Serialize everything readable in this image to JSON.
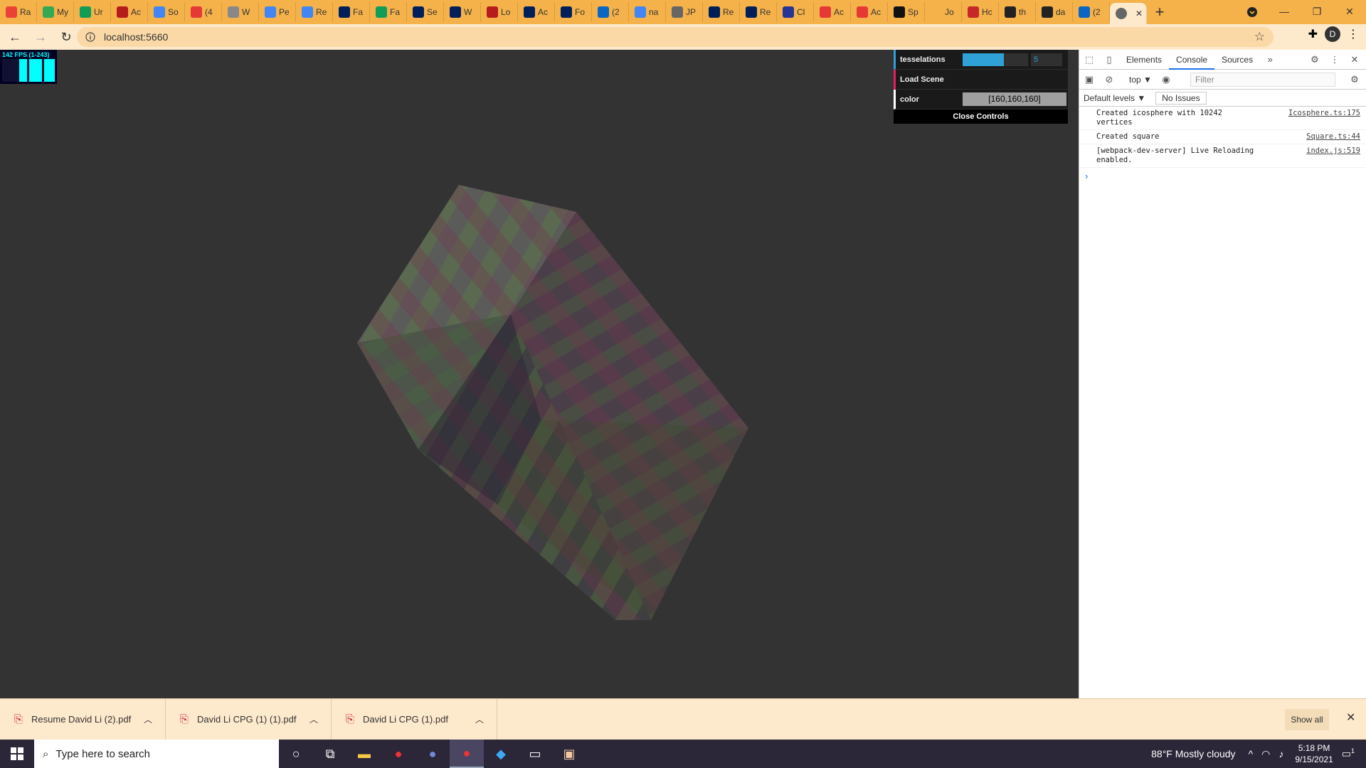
{
  "browser": {
    "tabs": [
      {
        "label": "Ra",
        "icon": "gmail-icon",
        "color": "#ea4335"
      },
      {
        "label": "My",
        "icon": "drive-icon",
        "color": "#34a853"
      },
      {
        "label": "Ur",
        "icon": "sheets-plus-icon",
        "color": "#0f9d58"
      },
      {
        "label": "Ac",
        "icon": "person-icon",
        "color": "#b71c1c"
      },
      {
        "label": "So",
        "icon": "fb-icon",
        "color": "#4285f4"
      },
      {
        "label": "(4",
        "icon": "h-icon",
        "color": "#e53935"
      },
      {
        "label": "W",
        "icon": "w-icon",
        "color": "#888888"
      },
      {
        "label": "Pe",
        "icon": "docs-icon",
        "color": "#4285f4"
      },
      {
        "label": "Re",
        "icon": "docs-icon",
        "color": "#4285f4"
      },
      {
        "label": "Fa",
        "icon": "penn-icon",
        "color": "#011f5b"
      },
      {
        "label": "Fa",
        "icon": "sheets-plus-icon",
        "color": "#0f9d58"
      },
      {
        "label": "Se",
        "icon": "penn-icon",
        "color": "#011f5b"
      },
      {
        "label": "W",
        "icon": "penn-icon",
        "color": "#011f5b"
      },
      {
        "label": "Lo",
        "icon": "person-icon",
        "color": "#b71c1c"
      },
      {
        "label": "Ac",
        "icon": "penn-icon",
        "color": "#011f5b"
      },
      {
        "label": "Fo",
        "icon": "penn-icon",
        "color": "#011f5b"
      },
      {
        "label": "(2",
        "icon": "linkedin-icon",
        "color": "#0a66c2"
      },
      {
        "label": "na",
        "icon": "google-icon",
        "color": "#4285f4"
      },
      {
        "label": "JP",
        "icon": "globe-icon",
        "color": "#666666"
      },
      {
        "label": "Re",
        "icon": "penn-icon",
        "color": "#011f5b"
      },
      {
        "label": "Re",
        "icon": "penn-icon",
        "color": "#011f5b"
      },
      {
        "label": "Cl",
        "icon": "calendar-icon",
        "color": "#283593"
      },
      {
        "label": "Ac",
        "icon": "acrobat-icon",
        "color": "#e53935"
      },
      {
        "label": "Ac",
        "icon": "acrobat-icon",
        "color": "#e53935"
      },
      {
        "label": "Sp",
        "icon": "x-icon",
        "color": "#111111"
      },
      {
        "label": "Jo",
        "icon": "blank-icon",
        "color": "#f5b24a"
      },
      {
        "label": "Hc",
        "icon": "hc-icon",
        "color": "#c62828"
      },
      {
        "label": "th",
        "icon": "github-icon",
        "color": "#222222"
      },
      {
        "label": "da",
        "icon": "github-icon",
        "color": "#222222"
      },
      {
        "label": "(2",
        "icon": "linkedin-icon",
        "color": "#0a66c2"
      }
    ],
    "url": "localhost:5660",
    "profile_initial": "D"
  },
  "stats": {
    "fps_text": "142 FPS (1-243)"
  },
  "gui": {
    "tesselations_label": "tesselations",
    "tesselations_value": "5",
    "tesselations_fraction": 0.63,
    "load_scene_label": "Load Scene",
    "color_label": "color",
    "color_value": "[160,160,160]",
    "close_label": "Close Controls"
  },
  "devtools": {
    "tabs": [
      "Elements",
      "Console",
      "Sources"
    ],
    "active_tab": "Console",
    "context": "top ▼",
    "filter_placeholder": "Filter",
    "levels": "Default levels ▼",
    "issues": "No Issues",
    "logs": [
      {
        "msg": "Created icosphere with 10242 vertices",
        "src": "Icosphere.ts:175"
      },
      {
        "msg": "Created square",
        "src": "Square.ts:44"
      },
      {
        "msg": "[webpack-dev-server] Live Reloading enabled.",
        "src": "index.js:519"
      }
    ],
    "prompt": "›"
  },
  "downloads": {
    "items": [
      "Resume David Li (2).pdf",
      "David Li CPG (1) (1).pdf",
      "David Li CPG (1).pdf"
    ],
    "show_all": "Show all"
  },
  "taskbar": {
    "search_placeholder": "Type here to search",
    "weather": "88°F  Mostly cloudy",
    "time": "5:18 PM",
    "date": "9/15/2021",
    "notification_count": "1"
  },
  "colors": {
    "tabstrip": "#f5b24a",
    "toolbar": "#fde9cc",
    "canvas": "#333333",
    "gui_slider": "#2fa1d6",
    "gui_function": "#e61d5f"
  }
}
